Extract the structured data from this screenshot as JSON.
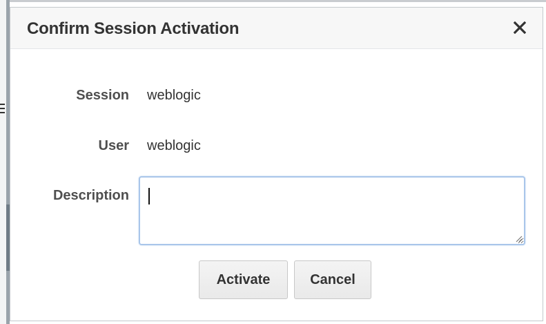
{
  "dialog": {
    "title": "Confirm Session Activation",
    "close_icon": "close-icon",
    "fields": {
      "session": {
        "label": "Session",
        "value": "weblogic"
      },
      "user": {
        "label": "User",
        "value": "weblogic"
      },
      "description": {
        "label": "Description",
        "value": "",
        "placeholder": ""
      }
    },
    "buttons": {
      "activate_label": "Activate",
      "cancel_label": "Cancel"
    }
  },
  "colors": {
    "header_bg": "#f7f7f7",
    "label_text": "#4f4f4f",
    "input_focus_border": "#a9c6ea",
    "button_bg": "#eeeeee"
  }
}
